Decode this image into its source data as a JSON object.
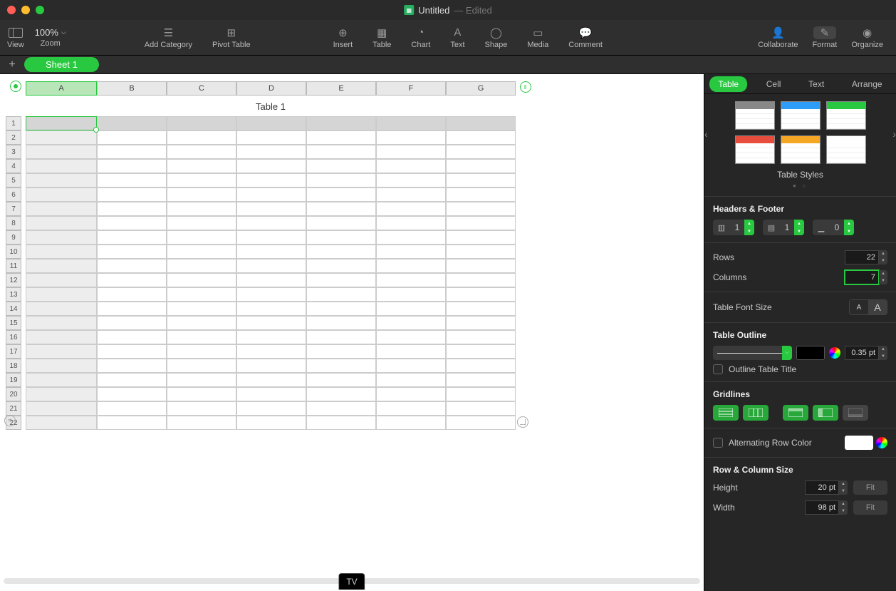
{
  "title": {
    "filename": "Untitled",
    "status": "— Edited"
  },
  "toolbar": {
    "view": "View",
    "zoom_label": "Zoom",
    "zoom_value": "100%",
    "add_category": "Add Category",
    "pivot_table": "Pivot Table",
    "insert": "Insert",
    "table": "Table",
    "chart": "Chart",
    "text": "Text",
    "shape": "Shape",
    "media": "Media",
    "comment": "Comment",
    "collaborate": "Collaborate",
    "format": "Format",
    "organize": "Organize"
  },
  "sheet_tab": "Sheet 1",
  "table_title": "Table 1",
  "columns": [
    "A",
    "B",
    "C",
    "D",
    "E",
    "F",
    "G"
  ],
  "rows": [
    "1",
    "2",
    "3",
    "4",
    "5",
    "6",
    "7",
    "8",
    "9",
    "10",
    "11",
    "12",
    "13",
    "14",
    "15",
    "16",
    "17",
    "18",
    "19",
    "20",
    "21",
    "22"
  ],
  "inspector": {
    "tabs": {
      "table": "Table",
      "cell": "Cell",
      "text": "Text",
      "arrange": "Arrange"
    },
    "styles_label": "Table Styles",
    "style_colors": [
      "#888888",
      "#2e9df7",
      "#28c840",
      "#e74c3c",
      "#f5a623",
      "#ffffff"
    ],
    "headers_footer": {
      "label": "Headers & Footer",
      "header_cols": "1",
      "header_rows": "1",
      "footer_rows": "0"
    },
    "rows": {
      "label": "Rows",
      "value": "22"
    },
    "cols": {
      "label": "Columns",
      "value": "7"
    },
    "font_size_label": "Table Font Size",
    "outline": {
      "label": "Table Outline",
      "width": "0.35 pt",
      "title_chk": "Outline Table Title"
    },
    "gridlines_label": "Gridlines",
    "alt_row_label": "Alternating Row Color",
    "size": {
      "label": "Row & Column Size",
      "height_label": "Height",
      "height": "20 pt",
      "width_label": "Width",
      "width": "98 pt",
      "fit": "Fit"
    }
  },
  "tv_badge": "TV"
}
